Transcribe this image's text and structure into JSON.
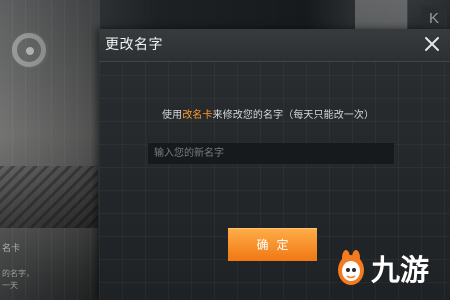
{
  "background": {
    "side_text_1": "名卡",
    "side_text_2": "的名字，",
    "side_text_3": "一天",
    "corner_logo": "K"
  },
  "dialog": {
    "title": "更改名字",
    "prompt_before": "使用",
    "highlight": "改名卡",
    "prompt_after": "来修改您的名字（每天只能改一次）",
    "input_placeholder": "输入您的新名字",
    "confirm_label": "确定",
    "close_icon": "close-icon"
  },
  "watermark": {
    "text": "九游"
  },
  "colors": {
    "accent": "#ff9c29",
    "button_top": "#ffae48",
    "button_bottom": "#f07814",
    "dialog_bg": "#24282b",
    "text": "#d8d8d8"
  }
}
